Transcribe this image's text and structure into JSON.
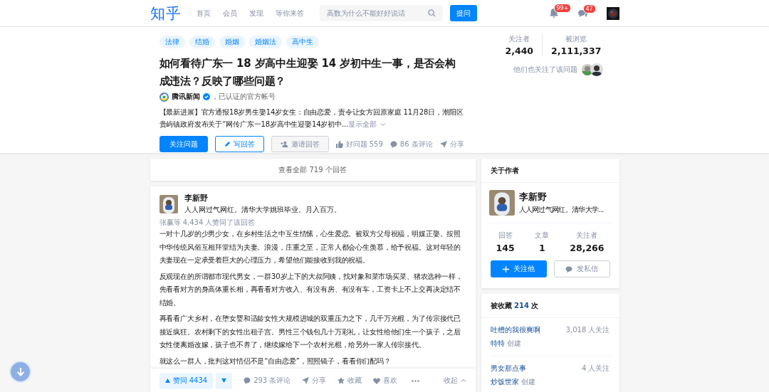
{
  "header": {
    "logo": "知乎",
    "nav": [
      "首页",
      "会员",
      "发现",
      "等你来答"
    ],
    "search": {
      "placeholder": "高数为什么不能好好说话"
    },
    "ask_button": "提问",
    "notifications_badge": "99+",
    "messages_badge": "47"
  },
  "question": {
    "topics": [
      "法律",
      "结婚",
      "婚姻",
      "婚姻法",
      "高中生"
    ],
    "title": "如何看待广东一 18 岁高中生迎娶 14 岁初中生一事，是否会构成违法？反映了哪些问题？",
    "author": {
      "name": "腾讯新闻",
      "verified": true,
      "note": "，已认证的官方帐号"
    },
    "excerpt": "【最新进展】官方通报18岁男生娶14岁女生：自由恋爱，责令让女方回原家庭 11月28日，潮阳区贵屿镇政府发布关于“网传广东一18岁高中生迎娶14岁初中...",
    "show_all": "显示全部",
    "actions": {
      "follow": "关注问题",
      "write": "写回答",
      "invite": "邀请回答",
      "good": "好问题 559",
      "comments": "86 条评论",
      "share": "分享"
    },
    "stats": [
      {
        "label": "关注者",
        "value": "2,440"
      },
      {
        "label": "被浏览",
        "value": "2,111,337"
      }
    ],
    "followers_note": "他们也关注了该问题"
  },
  "view_all": "查看全部 719 个回答",
  "answer": {
    "author": {
      "name": "李新野",
      "bio": "人人网过气网红。清华大学姚班毕业。月入百万。"
    },
    "voters": "张赢等 4,434 人赞同了该回答",
    "paragraphs": [
      "一对十几岁的少男少女，在乡村生活之中互生情愫，心生爱恋。被双方父母祝福，明媒正娶。按照中华传统风俗互相拜堂结为夫妻。浪漫，庄重之至，正常人都会心生羡慕，给予祝福。这对年轻的夫妻现在一定承受着巨大的心理压力，希望他们能接收到我的祝福。",
      "反观现在的所谓都市现代男女，一群30岁上下的大叔阿姨，找对象和菜市场买菜、猪农选种一样，先看看对方的身高体重长相，再看看对方收入、有没有房、有没有车，工资卡上不上交再决定结不结婚。",
      "再看看广大乡村，在堕女婴和适龄女性大规模进城的双重压力之下，几千万光棍，为了传宗接代已接近疯狂。农村剩下的女性出租子宫。男性三个钱包几十万彩礼，让女性给他们生一个孩子，之后女性便离婚改嫁，孩子也不养了，继续嫁给下一个农村光棍，给另外一家人传宗接代。",
      "就这么一群人，批判这对情侣不是“自由恋爱”，照照镜子，看看你们配吗？"
    ],
    "actions": {
      "vote": "赞同 4434",
      "comments": "293 条评论",
      "share": "分享",
      "collect": "收藏",
      "like": "喜欢",
      "collapse": "收起"
    }
  },
  "about_author": {
    "title": "关于作者",
    "name": "李新野",
    "bio": "人人网过气网红。清华大学...",
    "stats": [
      {
        "label": "回答",
        "value": "145"
      },
      {
        "label": "文章",
        "value": "1"
      },
      {
        "label": "关注者",
        "value": "28,266"
      }
    ],
    "follow": "关注他",
    "message": "发私信"
  },
  "collections": {
    "title_prefix": "被收藏",
    "count": "214",
    "title_suffix": "次",
    "items": [
      {
        "name": "吐槽的我很爽啊",
        "followers": "3,018 人关注",
        "creator": "特特",
        "created": "创建"
      },
      {
        "name": "男女那点事",
        "followers": "4 人关注",
        "creator": "炒饭世家",
        "created": "创建"
      }
    ]
  }
}
